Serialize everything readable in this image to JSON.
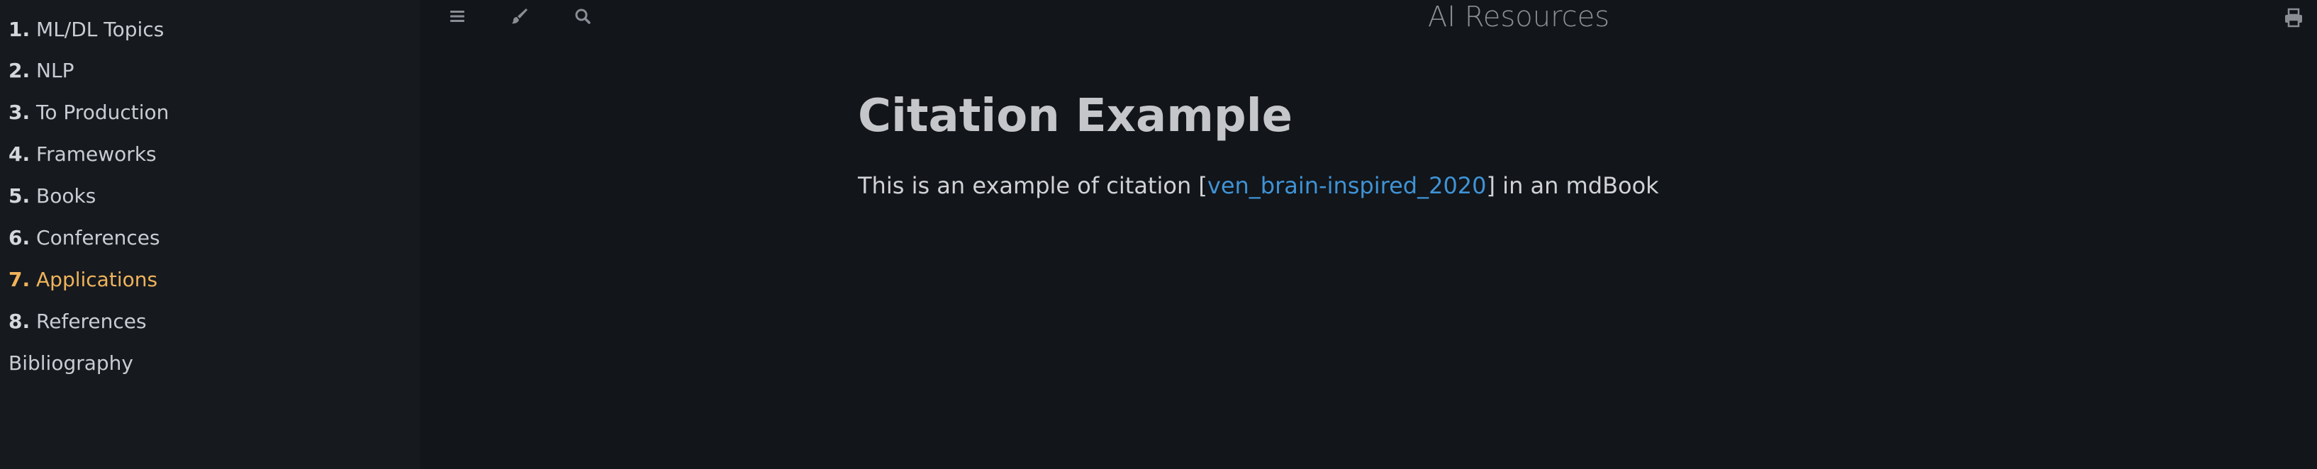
{
  "sidebar": {
    "items": [
      {
        "num": "1.",
        "label": "ML/DL Topics"
      },
      {
        "num": "2.",
        "label": "NLP"
      },
      {
        "num": "3.",
        "label": "To Production"
      },
      {
        "num": "4.",
        "label": "Frameworks"
      },
      {
        "num": "5.",
        "label": "Books"
      },
      {
        "num": "6.",
        "label": "Conferences"
      },
      {
        "num": "7.",
        "label": "Applications"
      },
      {
        "num": "8.",
        "label": "References"
      },
      {
        "num": "",
        "label": "Bibliography"
      }
    ],
    "active_index": 6
  },
  "menu_bar": {
    "book_title": "AI Resources",
    "icons": [
      "hamburger-icon",
      "paintbrush-icon",
      "search-icon",
      "print-icon"
    ]
  },
  "content": {
    "title": "Citation Example",
    "paragraph": {
      "before": "This is an example of citation [",
      "link": "ven_brain-inspired_2020",
      "after": "] in an mdBook"
    }
  },
  "colors": {
    "background": "#121519",
    "sidebar_background": "#161a1f",
    "active_item": "#f0b35b",
    "link": "#3f93d6",
    "text": "#d0d2d5"
  }
}
